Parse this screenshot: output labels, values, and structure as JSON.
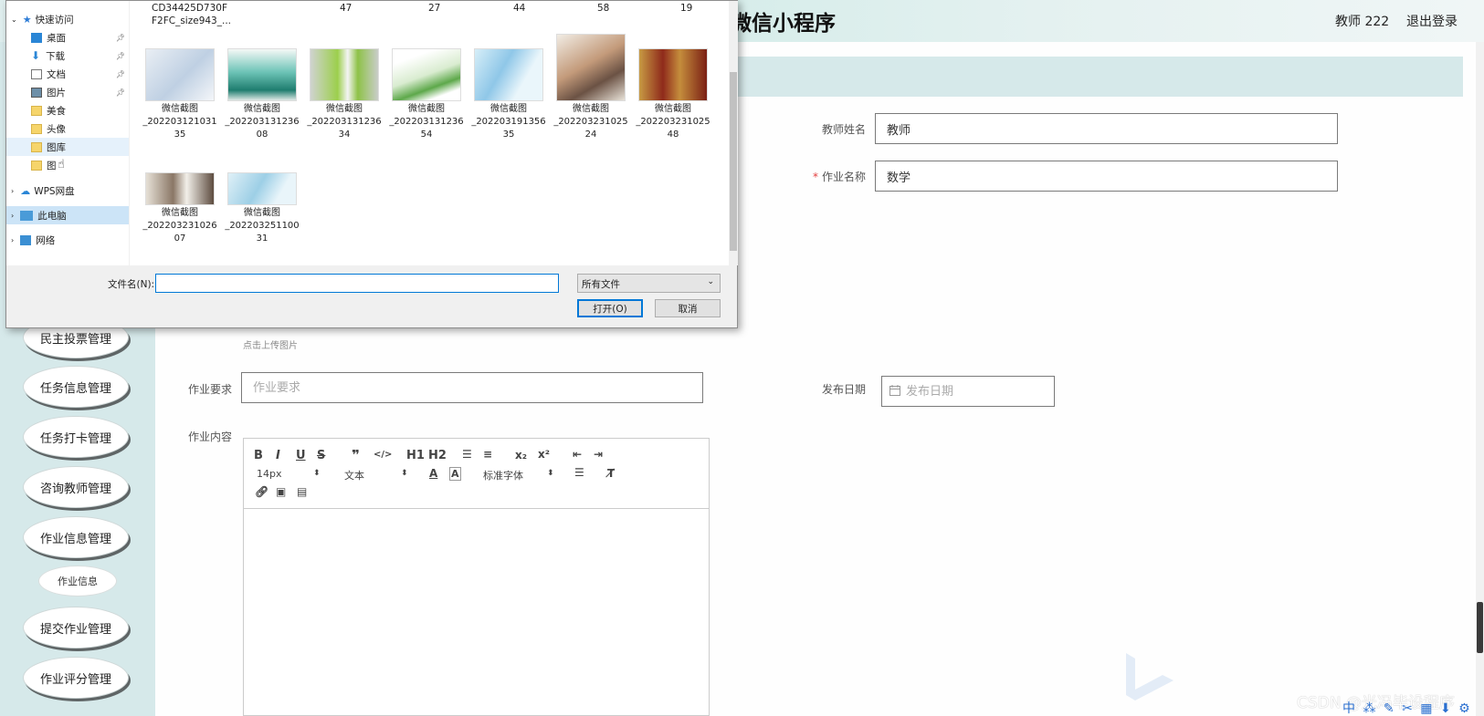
{
  "header": {
    "title": "微信小程序",
    "user": "教师 222",
    "logout": "退出登录"
  },
  "sidebar": {
    "items": [
      "民主投票管理",
      "任务信息管理",
      "任务打卡管理",
      "咨询教师管理",
      "作业信息管理",
      "提交作业管理",
      "作业评分管理"
    ],
    "sub_item": "作业信息"
  },
  "form": {
    "teacher_name_label": "教师姓名",
    "teacher_name_value": "教师",
    "homework_name_label": "作业名称",
    "homework_name_value": "数学",
    "required_mark": "*",
    "upload_hint": "点击上传图片",
    "requirement_label": "作业要求",
    "requirement_placeholder": "作业要求",
    "publish_date_label": "发布日期",
    "publish_date_placeholder": "发布日期",
    "content_label": "作业内容"
  },
  "editor": {
    "font_size": "14px",
    "text_type": "文本",
    "font_family": "标准字体",
    "h1": "H1",
    "h2": "H2"
  },
  "file_dialog": {
    "nav": {
      "quick_access": "快速访问",
      "desktop": "桌面",
      "downloads": "下载",
      "documents": "文档",
      "pictures": "图片",
      "food": "美食",
      "avatar": "头像",
      "gallery": "图库",
      "pic": "图",
      "wps": "WPS网盘",
      "this_pc": "此电脑",
      "network": "网络"
    },
    "top_row_partial": [
      "CD34425D730F",
      "F2FC_size943_...",
      "47",
      "27",
      "44",
      "58",
      "19"
    ],
    "files": [
      {
        "name1": "微信截图",
        "name2": "_202203121031",
        "name3": "35"
      },
      {
        "name1": "微信截图",
        "name2": "_202203131236",
        "name3": "08"
      },
      {
        "name1": "微信截图",
        "name2": "_202203131236",
        "name3": "34"
      },
      {
        "name1": "微信截图",
        "name2": "_202203131236",
        "name3": "54"
      },
      {
        "name1": "微信截图",
        "name2": "_202203191356",
        "name3": "35"
      },
      {
        "name1": "微信截图",
        "name2": "_202203231025",
        "name3": "24"
      },
      {
        "name1": "微信截图",
        "name2": "_202203231025",
        "name3": "48"
      },
      {
        "name1": "微信截图",
        "name2": "_202203231026",
        "name3": "07"
      },
      {
        "name1": "微信截图",
        "name2": "_202203251100",
        "name3": "31"
      }
    ],
    "filename_label": "文件名(N):",
    "filename_value": "",
    "filter": "所有文件",
    "open": "打开(O)",
    "cancel": "取消"
  },
  "watermark": "CSDN @光冯毕设程序",
  "colors": {
    "sidebar_bg": "#d6e9ea",
    "accent_blue": "#0078d7",
    "required": "#e23e3e"
  }
}
